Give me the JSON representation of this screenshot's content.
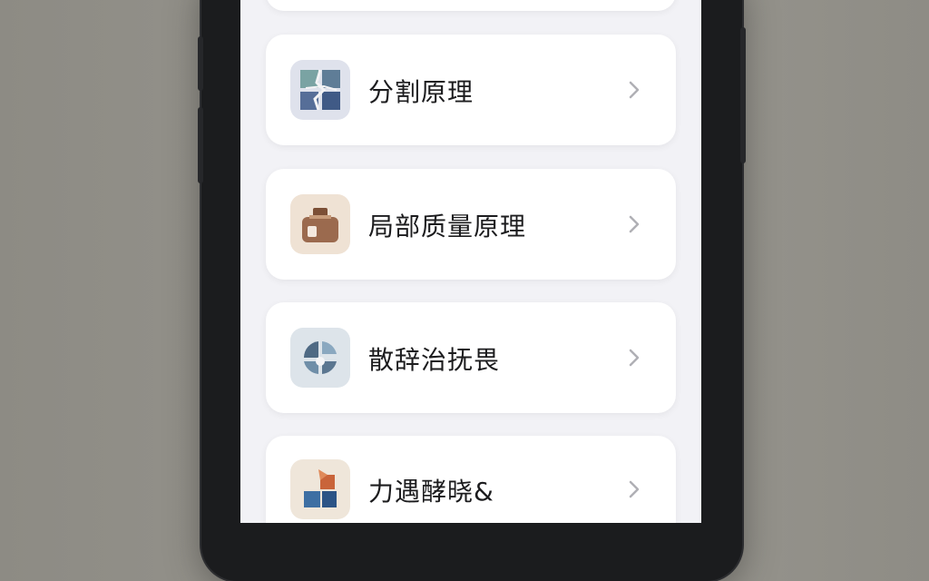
{
  "list": {
    "items": [
      {
        "label": "分割原理",
        "icon": "segmentation-icon"
      },
      {
        "label": "局部质量原理",
        "icon": "local-quality-icon"
      },
      {
        "label": "散辞治抚畏",
        "icon": "dispersion-icon"
      },
      {
        "label": "力遇酵晓&",
        "icon": "puzzle-icon"
      }
    ]
  },
  "colors": {
    "background": "#f2f2f6",
    "card": "#ffffff",
    "text": "#1c1c1e",
    "chevron": "#b0b0b5"
  }
}
